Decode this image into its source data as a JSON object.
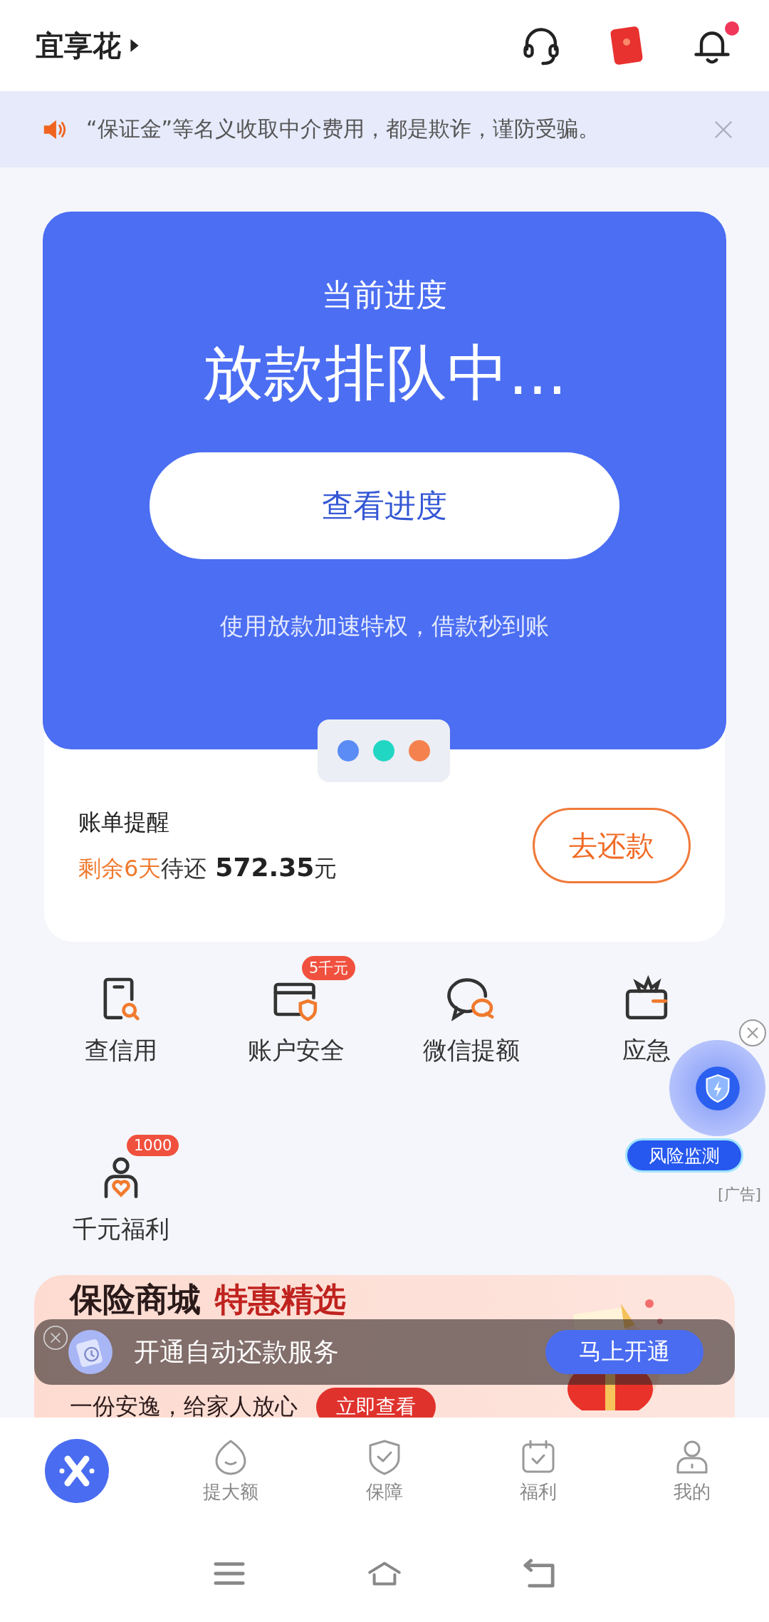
{
  "header": {
    "title": "宜享花",
    "has_notification": true
  },
  "notice": {
    "text": "“保证金”等名义收取中介费用，都是欺诈，谨防受骗。"
  },
  "progress_card": {
    "label": "当前进度",
    "status": "放款排队中...",
    "button": "查看进度",
    "tip": "使用放款加速特权，借款秒到账"
  },
  "carousel_dots": [
    {
      "color": "#5b8cf6"
    },
    {
      "color": "#22d6c4"
    },
    {
      "color": "#f5824e"
    }
  ],
  "bill": {
    "title": "账单提醒",
    "due_days": "剩余6天",
    "due_label": "待还",
    "amount": "572.35",
    "unit": "元",
    "button": "去还款"
  },
  "services": [
    {
      "kind": "credit",
      "label": "查信用"
    },
    {
      "kind": "account",
      "label": "账户安全",
      "badge": "5千元"
    },
    {
      "kind": "wechat",
      "label": "微信提额"
    },
    {
      "kind": "emergency",
      "label": "应急"
    },
    {
      "kind": "welfare",
      "label": "千元福利",
      "badge": "1000"
    }
  ],
  "risk_widget": {
    "label": "风险监测",
    "ad_tag": "[广告]"
  },
  "insurance_banner": {
    "title": "保险商城",
    "highlight": "特惠精选",
    "subtitle": "一份安逸，给家人放心",
    "button": "立即查看"
  },
  "autopay_bar": {
    "text": "开通自动还款服务",
    "button": "马上开通"
  },
  "bottom_nav": [
    {
      "kind": "logo",
      "selected": true
    },
    {
      "kind": "drop",
      "label": "提大额",
      "selected": false
    },
    {
      "kind": "shield",
      "label": "保障",
      "selected": false
    },
    {
      "kind": "calendar",
      "label": "福利",
      "selected": false
    },
    {
      "kind": "person",
      "label": "我的",
      "selected": false
    }
  ]
}
